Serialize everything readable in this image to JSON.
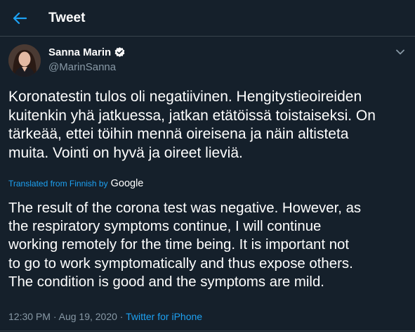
{
  "header": {
    "title": "Tweet",
    "back_icon": "arrow-left-icon",
    "accent_color": "#1da1f2"
  },
  "author": {
    "name": "Sanna Marin",
    "handle": "@MarinSanna",
    "verified_icon": "verified-badge-icon"
  },
  "tweet": {
    "text_lines": [
      "Koronatestin tulos oli negatiivinen. Hengitystieoireiden",
      "kuitenkin yhä jatkuessa, jatkan etätöissä toistaiseksi. On",
      "tärkeää, ettei töihin mennä oireisena ja näin altisteta",
      "muita. Vointi on hyvä ja oireet lieviä."
    ]
  },
  "translation": {
    "label": "Translated from Finnish by",
    "provider": "Google",
    "text_lines": [
      "The result of the corona test was negative. However, as",
      "the respiratory symptoms continue, I will continue",
      "working remotely for the time being. It is important not",
      "to go to work symptomatically and thus expose others.",
      "The condition is good and the symptoms are mild."
    ]
  },
  "meta": {
    "time": "12:30 PM",
    "separator": " · ",
    "date": "Aug 19, 2020",
    "source": "Twitter for iPhone"
  },
  "colors": {
    "background": "#15202b",
    "text": "#ffffff",
    "secondary_text": "#8899a6",
    "link": "#1da1f2"
  }
}
